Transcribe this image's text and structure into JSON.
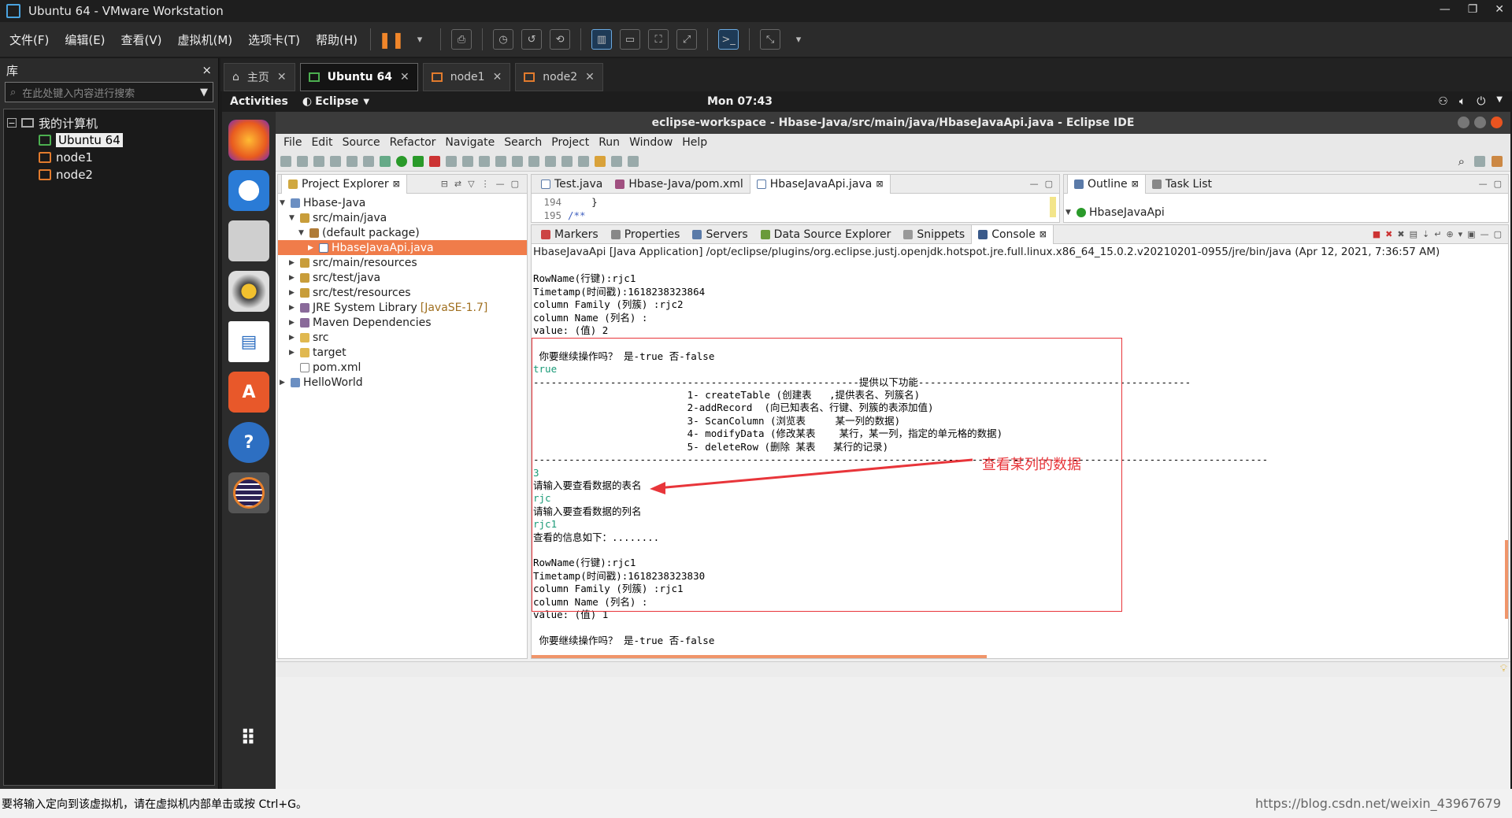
{
  "vm": {
    "title": "Ubuntu 64 - VMware Workstation",
    "menu": [
      "文件(F)",
      "编辑(E)",
      "查看(V)",
      "虚拟机(M)",
      "选项卡(T)",
      "帮助(H)"
    ],
    "library": {
      "title": "库",
      "close": "×",
      "search_placeholder": "在此处键入内容进行搜索",
      "root": "我的计算机",
      "machines": [
        "Ubuntu 64",
        "node1",
        "node2"
      ]
    },
    "tabs": [
      {
        "label": "主页"
      },
      {
        "label": "Ubuntu 64"
      },
      {
        "label": "node1"
      },
      {
        "label": "node2"
      }
    ],
    "status_text": "要将输入定向到该虚拟机，请在虚拟机内部单击或按 Ctrl+G。",
    "watermark": "https://blog.csdn.net/weixin_43967679"
  },
  "ubuntu": {
    "activities": "Activities",
    "app_menu": "Eclipse",
    "clock": "Mon 07:43"
  },
  "eclipse": {
    "title": "eclipse-workspace - Hbase-Java/src/main/java/HbaseJavaApi.java - Eclipse IDE",
    "menu": [
      "File",
      "Edit",
      "Source",
      "Refactor",
      "Navigate",
      "Search",
      "Project",
      "Run",
      "Window",
      "Help"
    ],
    "explorer_title": "Project Explorer",
    "tree": {
      "project": "Hbase-Java",
      "src_main_java": "src/main/java",
      "default_package": "(default package)",
      "selected_file": "HbaseJavaApi.java",
      "src_main_resources": "src/main/resources",
      "src_test_java": "src/test/java",
      "src_test_resources": "src/test/resources",
      "jre_lib": "JRE System Library",
      "jre_version": "[JavaSE-1.7]",
      "maven": "Maven Dependencies",
      "src": "src",
      "target": "target",
      "pom": "pom.xml",
      "hello": "HelloWorld"
    },
    "editor_tabs": [
      "Test.java",
      "Hbase-Java/pom.xml",
      "HbaseJavaApi.java"
    ],
    "editor_lines": [
      {
        "num": "194",
        "code": "    }"
      },
      {
        "num": "195",
        "code": "/**"
      }
    ],
    "outline_tabs": [
      "Outline",
      "Task List"
    ],
    "outline_item": "HbaseJavaApi",
    "bottom_tabs": [
      "Markers",
      "Properties",
      "Servers",
      "Data Source Explorer",
      "Snippets",
      "Console"
    ],
    "console_header": "HbaseJavaApi [Java Application] /opt/eclipse/plugins/org.eclipse.justj.openjdk.hotspot.jre.full.linux.x86_64_15.0.2.v20210201-0955/jre/bin/java  (Apr 12, 2021, 7:36:57 AM)",
    "console_lines": [
      {
        "text": "",
        "green": false
      },
      {
        "text": "RowName(行键):rjc1",
        "green": false
      },
      {
        "text": "Timetamp(时间戳):1618238323864",
        "green": false
      },
      {
        "text": "column Family (列簇) :rjc2",
        "green": false
      },
      {
        "text": "column Name (列名) :",
        "green": false
      },
      {
        "text": "value: (值) 2",
        "green": false
      },
      {
        "text": "",
        "green": false
      },
      {
        "text": " 你要继续操作吗？ 是-true 否-false",
        "green": false
      },
      {
        "text": "true",
        "green": true
      },
      {
        "text": "-------------------------------------------------------提供以下功能----------------------------------------------",
        "green": false
      },
      {
        "text": "                          1- createTable (创建表   ,提供表名、列簇名)",
        "green": false
      },
      {
        "text": "                          2-addRecord  (向已知表名、行键、列簇的表添加值)",
        "green": false
      },
      {
        "text": "                          3- ScanColumn (浏览表     某一列的数据)",
        "green": false
      },
      {
        "text": "                          4- modifyData (修改某表    某行，某一列，指定的单元格的数据)",
        "green": false
      },
      {
        "text": "                          5- deleteRow (删除 某表   某行的记录)",
        "green": false
      },
      {
        "text": "----------------------------------------------------------------------------------------------------------------------------",
        "green": false
      },
      {
        "text": "3",
        "green": true
      },
      {
        "text": "请输入要查看数据的表名",
        "green": false
      },
      {
        "text": "rjc",
        "green": true
      },
      {
        "text": "请输入要查看数据的列名",
        "green": false
      },
      {
        "text": "rjc1",
        "green": true
      },
      {
        "text": "查看的信息如下：........",
        "green": false
      },
      {
        "text": "",
        "green": false
      },
      {
        "text": "RowName(行键):rjc1",
        "green": false
      },
      {
        "text": "Timetamp(时间戳):1618238323830",
        "green": false
      },
      {
        "text": "column Family (列簇) :rjc1",
        "green": false
      },
      {
        "text": "column Name (列名) :",
        "green": false
      },
      {
        "text": "value: (值) 1",
        "green": false
      },
      {
        "text": "",
        "green": false
      },
      {
        "text": " 你要继续操作吗？ 是-true 否-false",
        "green": false
      }
    ],
    "annotation": "查看某列的数据"
  },
  "colors": {
    "selection": "#f07c4a",
    "annotation": "#e8353a",
    "console_input": "#1a9a77"
  }
}
